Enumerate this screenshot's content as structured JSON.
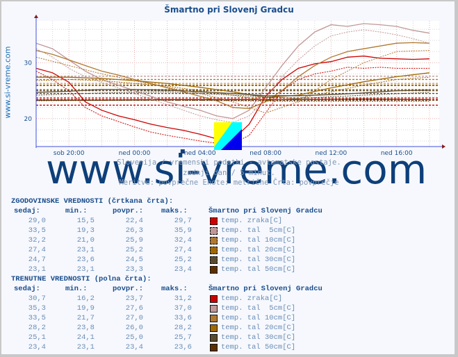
{
  "title": "Šmartno pri Slovenj Gradcu",
  "side_label": "www.si-vreme.com",
  "watermark": "www.si-vreme.com",
  "subtitle_lines": [
    "Slovenija / vremenski podatki - avtomatske postaje.",
    "zadnji dan / 5 minut.",
    "Meritve: povprečne  Enote: metrične  Črta: povprečje"
  ],
  "chart_data": {
    "type": "line",
    "title": "Šmartno pri Slovenj Gradcu",
    "xlabel": "",
    "ylabel": "",
    "x_ticks": [
      "sob 20:00",
      "ned 00:00",
      "ned 04:00",
      "ned 08:00",
      "ned 12:00",
      "ned 16:00"
    ],
    "x_tick_hours": [
      2,
      6,
      10,
      14,
      18,
      22
    ],
    "xlim_hours": [
      0,
      24.6
    ],
    "y_ticks": [
      20,
      30
    ],
    "ylim": [
      15,
      37.5
    ],
    "grid": true,
    "series": [
      {
        "name": "temp. zraka[C]",
        "color": "#cc0000",
        "style": "solid",
        "x": [
          0,
          1,
          2,
          3,
          4,
          5,
          6,
          7,
          8,
          9,
          10,
          11,
          12,
          13,
          14,
          15,
          16,
          17,
          18,
          19,
          20,
          21,
          22,
          23,
          24
        ],
        "values": [
          29.0,
          28.2,
          26.5,
          23.0,
          21.5,
          20.5,
          19.8,
          19.0,
          18.4,
          17.9,
          17.2,
          16.4,
          16.2,
          19.0,
          24.0,
          27.0,
          29.0,
          29.8,
          30.2,
          31.0,
          31.2,
          30.8,
          30.7,
          30.6,
          30.7
        ]
      },
      {
        "name": "temp. tal  5cm[C]",
        "color": "#c09898",
        "style": "solid",
        "x": [
          0,
          1,
          2,
          3,
          4,
          5,
          6,
          7,
          8,
          9,
          10,
          11,
          12,
          13,
          14,
          15,
          16,
          17,
          18,
          19,
          20,
          21,
          22,
          23,
          24
        ],
        "values": [
          33.5,
          32.5,
          30.5,
          28.5,
          27.0,
          26.0,
          25.0,
          24.0,
          23.0,
          22.2,
          21.5,
          20.5,
          20.0,
          21.5,
          25.5,
          29.5,
          33.0,
          35.5,
          36.8,
          36.5,
          37.0,
          36.8,
          36.5,
          35.8,
          35.3
        ]
      },
      {
        "name": "temp. tal 10cm[C]",
        "color": "#b07830",
        "style": "solid",
        "x": [
          0,
          1,
          2,
          3,
          4,
          5,
          6,
          7,
          8,
          9,
          10,
          11,
          12,
          13,
          14,
          15,
          16,
          17,
          18,
          19,
          20,
          21,
          22,
          23,
          24
        ],
        "values": [
          32.2,
          31.5,
          30.5,
          29.5,
          28.5,
          27.8,
          27.0,
          26.3,
          25.5,
          24.8,
          24.0,
          23.2,
          22.0,
          21.8,
          23.0,
          25.0,
          27.5,
          29.5,
          31.0,
          32.0,
          32.5,
          33.0,
          33.5,
          33.6,
          33.5
        ]
      },
      {
        "name": "temp. tal 20cm[C]",
        "color": "#a06800",
        "style": "solid",
        "x": [
          0,
          2,
          4,
          6,
          8,
          10,
          12,
          14,
          16,
          18,
          20,
          22,
          24
        ],
        "values": [
          27.4,
          27.4,
          27.2,
          26.8,
          26.3,
          25.6,
          24.8,
          23.8,
          24.2,
          25.5,
          26.6,
          27.5,
          28.2
        ]
      },
      {
        "name": "temp. tal 30cm[C]",
        "color": "#5a4a30",
        "style": "solid",
        "x": [
          0,
          2,
          4,
          6,
          8,
          10,
          12,
          14,
          16,
          18,
          20,
          22,
          24
        ],
        "values": [
          24.7,
          24.9,
          25.2,
          25.2,
          25.1,
          24.8,
          24.5,
          24.1,
          24.1,
          24.3,
          24.6,
          25.0,
          25.1
        ]
      },
      {
        "name": "temp. tal 50cm[C]",
        "color": "#5c2e00",
        "style": "solid",
        "x": [
          0,
          4,
          8,
          12,
          16,
          20,
          24
        ],
        "values": [
          23.3,
          23.3,
          23.4,
          23.4,
          23.4,
          23.5,
          23.4
        ]
      },
      {
        "name": "temp. zraka[C] (prejšnji dan)",
        "color": "#cc0000",
        "style": "dashed",
        "x": [
          0,
          1,
          2,
          3,
          4,
          5,
          6,
          7,
          8,
          9,
          10,
          11,
          12,
          13,
          14,
          15,
          16,
          17,
          18,
          19,
          20,
          21,
          22,
          23,
          24
        ],
        "values": [
          28.5,
          27.0,
          25.0,
          22.0,
          20.5,
          19.5,
          18.5,
          17.6,
          17.0,
          16.5,
          16.0,
          15.6,
          15.5,
          17.0,
          21.0,
          25.0,
          27.0,
          28.0,
          28.5,
          29.2,
          29.0,
          29.2,
          29.0,
          29.0,
          29.0
        ]
      },
      {
        "name": "temp. tal  5cm[C] (prejšnji dan)",
        "color": "#c09898",
        "style": "dashed",
        "x": [
          0,
          1,
          2,
          3,
          4,
          5,
          6,
          7,
          8,
          9,
          10,
          11,
          12,
          13,
          14,
          15,
          16,
          17,
          18,
          19,
          20,
          21,
          22,
          23,
          24
        ],
        "values": [
          32.5,
          31.0,
          29.0,
          27.5,
          26.5,
          25.5,
          24.5,
          23.5,
          22.5,
          21.5,
          20.5,
          19.8,
          19.3,
          20.5,
          23.5,
          27.5,
          30.5,
          33.0,
          34.8,
          35.5,
          35.9,
          35.5,
          35.0,
          34.3,
          33.5
        ]
      },
      {
        "name": "temp. tal 10cm[C] (prejšnji dan)",
        "color": "#b07830",
        "style": "dashed",
        "x": [
          0,
          2,
          4,
          6,
          8,
          10,
          12,
          14,
          16,
          18,
          20,
          22,
          24
        ],
        "values": [
          31.0,
          29.5,
          28.0,
          26.8,
          25.6,
          24.5,
          23.0,
          21.0,
          23.0,
          27.0,
          30.0,
          32.0,
          32.2
        ]
      },
      {
        "name": "temp. tal 20cm[C] (prejšnji dan)",
        "color": "#a06800",
        "style": "dashed",
        "x": [
          0,
          2,
          4,
          6,
          8,
          10,
          12,
          14,
          16,
          18,
          20,
          22,
          24
        ],
        "values": [
          26.8,
          27.0,
          26.8,
          26.3,
          25.8,
          25.0,
          24.2,
          23.2,
          23.6,
          24.8,
          26.0,
          27.0,
          27.4
        ]
      },
      {
        "name": "temp. tal 30cm[C] (prejšnji dan)",
        "color": "#5a4a30",
        "style": "dashed",
        "x": [
          0,
          4,
          8,
          12,
          16,
          20,
          24
        ],
        "values": [
          24.2,
          24.6,
          24.8,
          24.2,
          23.6,
          24.2,
          24.7
        ]
      },
      {
        "name": "temp. tal 50cm[C] (prejšnji dan)",
        "color": "#5c2e00",
        "style": "dashed",
        "x": [
          0,
          8,
          16,
          24
        ],
        "values": [
          23.2,
          23.3,
          23.1,
          23.1
        ]
      }
    ],
    "avg_lines": [
      {
        "color": "#cc0000",
        "value": 22.4
      },
      {
        "color": "#c09898",
        "value": 26.3
      },
      {
        "color": "#b07830",
        "value": 25.9
      },
      {
        "color": "#a06800",
        "value": 25.2
      },
      {
        "color": "#5a4a30",
        "value": 24.5
      },
      {
        "color": "#5c2e00",
        "value": 23.3
      },
      {
        "color": "#cc0000",
        "value": 23.7
      },
      {
        "color": "#c09898",
        "value": 27.6
      },
      {
        "color": "#b07830",
        "value": 27.0
      },
      {
        "color": "#a06800",
        "value": 26.0
      },
      {
        "color": "#5a4a30",
        "value": 25.0
      },
      {
        "color": "#5c2e00",
        "value": 23.4
      }
    ]
  },
  "historic": {
    "heading": "ZGODOVINSKE VREDNOSTI (črtkana črta):",
    "cols": [
      "sedaj:",
      "min.:",
      "povpr.:",
      "maks.:"
    ],
    "station": "Šmartno pri Slovenj Gradcu",
    "rows": [
      {
        "now": "29,0",
        "min": "15,5",
        "avg": "22,4",
        "max": "29,7",
        "label": "temp. zraka[C]",
        "color": "#cc0000"
      },
      {
        "now": "33,5",
        "min": "19,3",
        "avg": "26,3",
        "max": "35,9",
        "label": "temp. tal  5cm[C]",
        "color": "#c09898"
      },
      {
        "now": "32,2",
        "min": "21,0",
        "avg": "25,9",
        "max": "32,4",
        "label": "temp. tal 10cm[C]",
        "color": "#b07830"
      },
      {
        "now": "27,4",
        "min": "23,1",
        "avg": "25,2",
        "max": "27,4",
        "label": "temp. tal 20cm[C]",
        "color": "#a06800"
      },
      {
        "now": "24,7",
        "min": "23,6",
        "avg": "24,5",
        "max": "25,2",
        "label": "temp. tal 30cm[C]",
        "color": "#5a4a30"
      },
      {
        "now": "23,1",
        "min": "23,1",
        "avg": "23,3",
        "max": "23,4",
        "label": "temp. tal 50cm[C]",
        "color": "#5c2e00"
      }
    ]
  },
  "current": {
    "heading": "TRENUTNE VREDNOSTI (polna črta):",
    "cols": [
      "sedaj:",
      "min.:",
      "povpr.:",
      "maks.:"
    ],
    "station": "Šmartno pri Slovenj Gradcu",
    "rows": [
      {
        "now": "30,7",
        "min": "16,2",
        "avg": "23,7",
        "max": "31,2",
        "label": "temp. zraka[C]",
        "color": "#cc0000"
      },
      {
        "now": "35,3",
        "min": "19,9",
        "avg": "27,6",
        "max": "37,0",
        "label": "temp. tal  5cm[C]",
        "color": "#c09898"
      },
      {
        "now": "33,5",
        "min": "21,7",
        "avg": "27,0",
        "max": "33,6",
        "label": "temp. tal 10cm[C]",
        "color": "#b07830"
      },
      {
        "now": "28,2",
        "min": "23,8",
        "avg": "26,0",
        "max": "28,2",
        "label": "temp. tal 20cm[C]",
        "color": "#a06800"
      },
      {
        "now": "25,1",
        "min": "24,1",
        "avg": "25,0",
        "max": "25,7",
        "label": "temp. tal 30cm[C]",
        "color": "#5a4a30"
      },
      {
        "now": "23,4",
        "min": "23,1",
        "avg": "23,4",
        "max": "23,6",
        "label": "temp. tal 50cm[C]",
        "color": "#5c2e00"
      }
    ]
  }
}
